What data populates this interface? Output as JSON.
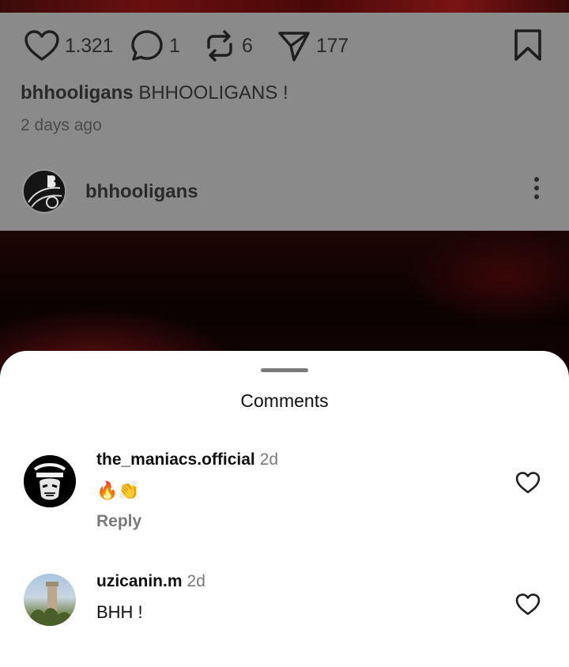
{
  "post": {
    "likes": "1.321",
    "comments": "1",
    "reposts": "6",
    "shares": "177",
    "caption_user": "bhhooligans",
    "caption_text": "BHHOOLIGANS !",
    "time": "2 days ago",
    "author": "bhhooligans"
  },
  "icons": {
    "like": "heart-icon",
    "comment": "comment-bubble-icon",
    "repost": "repost-icon",
    "share": "send-icon",
    "bookmark": "bookmark-icon",
    "more": "more-vertical-icon"
  },
  "sheet": {
    "title": "Comments"
  },
  "comments": [
    {
      "user": "the_maniacs.official",
      "ago": "2d",
      "text": "🔥👏",
      "reply": "Reply"
    },
    {
      "user": "uzicanin.m",
      "ago": "2d",
      "text": "BHH !"
    }
  ]
}
